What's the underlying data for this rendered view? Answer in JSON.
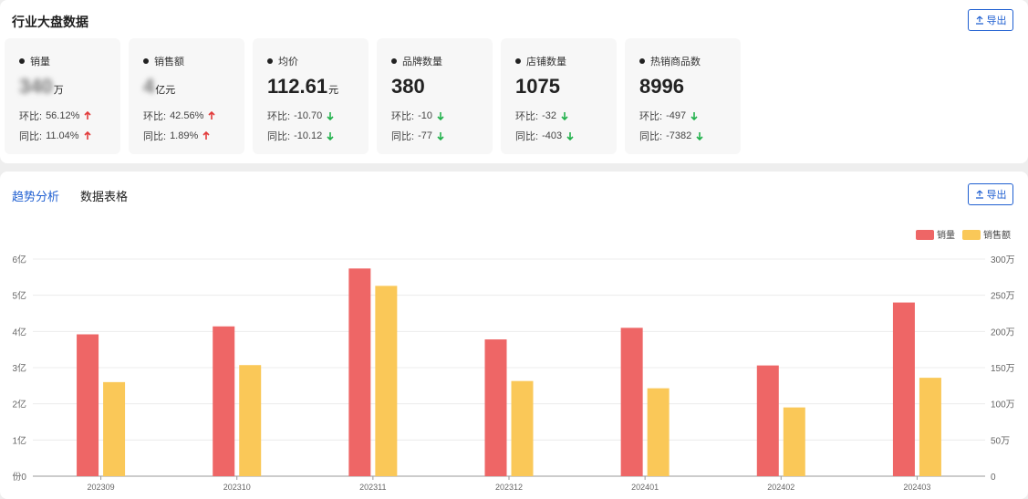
{
  "header": {
    "title": "行业大盘数据",
    "export_label": "导出"
  },
  "cards": [
    {
      "name": "销量",
      "value": "340",
      "unit": "万",
      "blurred": true,
      "mom_label": "环比:",
      "mom": "56.12%",
      "mom_dir": "up",
      "yoy_label": "同比:",
      "yoy": "11.04%",
      "yoy_dir": "up"
    },
    {
      "name": "销售额",
      "value": "4",
      "unit": "亿元",
      "blurred": true,
      "mom_label": "环比:",
      "mom": "42.56%",
      "mom_dir": "up",
      "yoy_label": "同比:",
      "yoy": "1.89%",
      "yoy_dir": "up"
    },
    {
      "name": "均价",
      "value": "112.61",
      "unit": "元",
      "blurred": false,
      "mom_label": "环比:",
      "mom": "-10.70",
      "mom_dir": "down",
      "yoy_label": "同比:",
      "yoy": "-10.12",
      "yoy_dir": "down"
    },
    {
      "name": "品牌数量",
      "value": "380",
      "unit": "",
      "blurred": false,
      "mom_label": "环比:",
      "mom": "-10",
      "mom_dir": "down",
      "yoy_label": "同比:",
      "yoy": "-77",
      "yoy_dir": "down"
    },
    {
      "name": "店铺数量",
      "value": "1075",
      "unit": "",
      "blurred": false,
      "mom_label": "环比:",
      "mom": "-32",
      "mom_dir": "down",
      "yoy_label": "同比:",
      "yoy": "-403",
      "yoy_dir": "down"
    },
    {
      "name": "热销商品数",
      "value": "8996",
      "unit": "",
      "blurred": false,
      "mom_label": "环比:",
      "mom": "-497",
      "mom_dir": "down",
      "yoy_label": "同比:",
      "yoy": "-7382",
      "yoy_dir": "down"
    }
  ],
  "tabs": [
    {
      "label": "趋势分析",
      "active": true
    },
    {
      "label": "数据表格",
      "active": false
    }
  ],
  "colors": {
    "accent": "#1f5fd1",
    "up": "#e23b3b",
    "down": "#22b14c",
    "series_sales": "#ee6666",
    "series_revenue": "#fac858"
  },
  "chart_data": {
    "type": "bar",
    "categories": [
      "202309",
      "202310",
      "202311",
      "202312",
      "202401",
      "202402",
      "202403"
    ],
    "series": [
      {
        "name": "销量",
        "axis": "right",
        "values": [
          196,
          207,
          287,
          189,
          205,
          153,
          240
        ]
      },
      {
        "name": "销售额",
        "axis": "left",
        "values": [
          2.6,
          3.07,
          5.26,
          2.63,
          2.43,
          1.9,
          2.72
        ]
      }
    ],
    "left_axis": {
      "ticks": [
        "份0",
        "1亿",
        "2亿",
        "3亿",
        "4亿",
        "5亿",
        "6亿"
      ],
      "range": [
        0,
        6
      ]
    },
    "right_axis": {
      "ticks": [
        "0",
        "50万",
        "100万",
        "150万",
        "200万",
        "250万",
        "300万"
      ],
      "range": [
        0,
        300
      ]
    },
    "legend_position": "top-right",
    "grid": true
  }
}
